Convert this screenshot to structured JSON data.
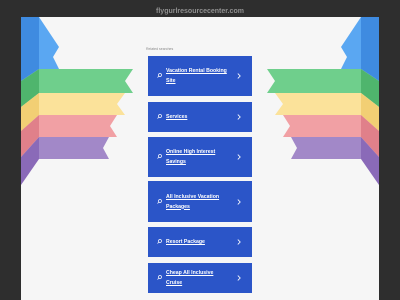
{
  "site": {
    "domain": "flygurlresourcecenter.com"
  },
  "related": {
    "heading": "Related searches",
    "items": [
      {
        "label": "Vacation Rental Booking Site"
      },
      {
        "label": "Services"
      },
      {
        "label": "Online High Interest Savings"
      },
      {
        "label": "All Inclusive Vacation Packages"
      },
      {
        "label": "Resort Package"
      },
      {
        "label": "Cheap All Inclusive Cruise"
      }
    ]
  },
  "icons": {
    "search": "search-icon",
    "chevron": "chevron-right-icon"
  },
  "colors": {
    "card": "#2b55c8",
    "page_bg": "#f6f6f6",
    "frame_bg": "#2e2e2e",
    "ribbons": [
      "#5aa7f2",
      "#6fcf8c",
      "#fbe29a",
      "#f1a0a4",
      "#a288c8"
    ]
  }
}
